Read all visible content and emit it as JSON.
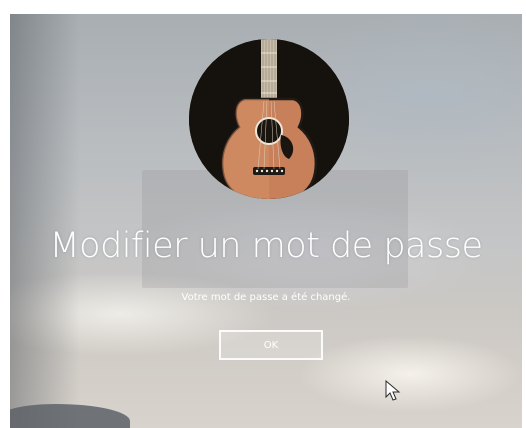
{
  "dialog": {
    "title": "Modifier un mot de passe",
    "message": "Votre mot de passe a été changé.",
    "ok_label": "OK"
  },
  "avatar": {
    "icon": "guitar-avatar-icon"
  },
  "cursor": {
    "icon": "mouse-pointer-icon"
  }
}
